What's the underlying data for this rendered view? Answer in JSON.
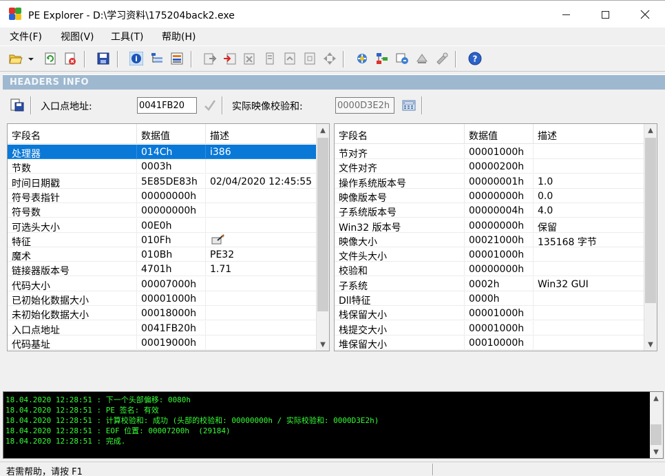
{
  "window": {
    "title": "PE Explorer - D:\\学习资料\\175204back2.exe"
  },
  "menu": {
    "items": [
      "文件(F)",
      "视图(V)",
      "工具(T)",
      "帮助(H)"
    ]
  },
  "toolbar": {
    "icons": [
      "open-icon",
      "dropdown-icon",
      "refresh-icon",
      "close-file-icon",
      "save-icon",
      "headers-info-icon",
      "data-directories-icon",
      "section-headers-icon",
      "export-icon",
      "import-icon",
      "resources-icon",
      "debug-icon",
      "page-icon",
      "copy-icon",
      "navigate-icon",
      "disassembler-icon",
      "dependency-icon",
      "resource-editor-icon",
      "unpack-icon",
      "tools-icon",
      "help-icon"
    ]
  },
  "section_title": "HEADERS INFO",
  "fields": {
    "entry_point_label": "入口点地址:",
    "entry_point_value": "0041FB20",
    "checksum_label": "实际映像校验和:",
    "checksum_value": "0000D3E2h"
  },
  "left_table": {
    "columns": [
      "字段名",
      "数据值",
      "描述"
    ],
    "rows": [
      [
        "处理器",
        "014Ch",
        "i386"
      ],
      [
        "节数",
        "0003h",
        ""
      ],
      [
        "时间日期戳",
        "5E85DE83h",
        "02/04/2020 12:45:55"
      ],
      [
        "符号表指针",
        "00000000h",
        ""
      ],
      [
        "符号数",
        "00000000h",
        ""
      ],
      [
        "可选头大小",
        "00E0h",
        ""
      ],
      [
        "特征",
        "010Fh",
        ""
      ],
      [
        "魔术",
        "010Bh",
        "PE32"
      ],
      [
        "链接器版本号",
        "4701h",
        "1.71"
      ],
      [
        "代码大小",
        "00007000h",
        ""
      ],
      [
        "已初始化数据大小",
        "00001000h",
        ""
      ],
      [
        "未初始化数据大小",
        "00018000h",
        ""
      ],
      [
        "入口点地址",
        "0041FB20h",
        ""
      ],
      [
        "代码基址",
        "00019000h",
        ""
      ]
    ]
  },
  "right_table": {
    "columns": [
      "字段名",
      "数据值",
      "描述"
    ],
    "rows": [
      [
        "节对齐",
        "00001000h",
        ""
      ],
      [
        "文件对齐",
        "00000200h",
        ""
      ],
      [
        "操作系统版本号",
        "00000001h",
        "1.0"
      ],
      [
        "映像版本号",
        "00000000h",
        "0.0"
      ],
      [
        "子系统版本号",
        "00000004h",
        "4.0"
      ],
      [
        "Win32 版本号",
        "00000000h",
        "保留"
      ],
      [
        "映像大小",
        "00021000h",
        "135168 字节"
      ],
      [
        "文件头大小",
        "00001000h",
        ""
      ],
      [
        "校验和",
        "00000000h",
        ""
      ],
      [
        "子系统",
        "0002h",
        "Win32 GUI"
      ],
      [
        "Dll特征",
        "0000h",
        ""
      ],
      [
        "栈保留大小",
        "00001000h",
        ""
      ],
      [
        "栈提交大小",
        "00001000h",
        ""
      ],
      [
        "堆保留大小",
        "00010000h",
        ""
      ]
    ]
  },
  "log": [
    "18.04.2020 12:28:51 : 下一个头部偏移: 0080h",
    "18.04.2020 12:28:51 : PE 签名: 有效",
    "18.04.2020 12:28:51 : 计算校验和: 成功 (头部的校验和: 00000000h / 实际校验和: 0000D3E2h)",
    "18.04.2020 12:28:51 : EOF 位置: 00007200h  (29184)",
    "18.04.2020 12:28:51 : 完成."
  ],
  "status": "若需帮助，请按 F1",
  "colors": {
    "selection": "#0a78d7",
    "header_band": "#9eb8cf",
    "log_text": "#35ff35"
  }
}
